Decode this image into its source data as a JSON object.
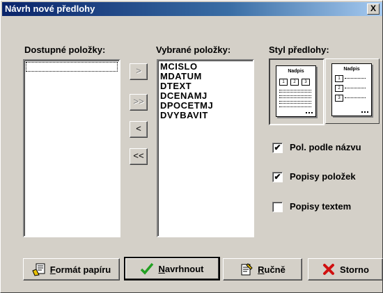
{
  "window": {
    "title": "Návrh nové předlohy",
    "close_label": "X"
  },
  "labels": {
    "available": "Dostupné položky:",
    "selected": "Vybrané položky:",
    "style": "Styl předlohy:"
  },
  "selected_items": [
    "MCISLO",
    "MDATUM",
    "DTEXT",
    "DCENAMJ",
    "DPOCETMJ",
    "DVYBAVIT"
  ],
  "transfer_buttons": {
    "add": ">",
    "add_all": ">>",
    "remove": "<",
    "remove_all": "<<"
  },
  "style_preview": {
    "header_text": "Nadpis",
    "col_numbers": [
      "1",
      "2",
      "3"
    ],
    "row_numbers": [
      "1",
      "2",
      "3"
    ]
  },
  "options": [
    {
      "label": "Pol. podle názvu",
      "checked": true
    },
    {
      "label": "Popisy položek",
      "checked": true
    },
    {
      "label": "Popisy textem",
      "checked": false
    }
  ],
  "buttons": {
    "format_first": "F",
    "format_rest": "ormát papíru",
    "design_first": "N",
    "design_rest": "avrhnout",
    "manual_first": "R",
    "manual_rest": "učně",
    "cancel": "Storno"
  },
  "colors": {
    "face": "#d4d0c8",
    "title_bar": "#0a246a",
    "ok_green": "#22a022",
    "cancel_red": "#d01010"
  }
}
